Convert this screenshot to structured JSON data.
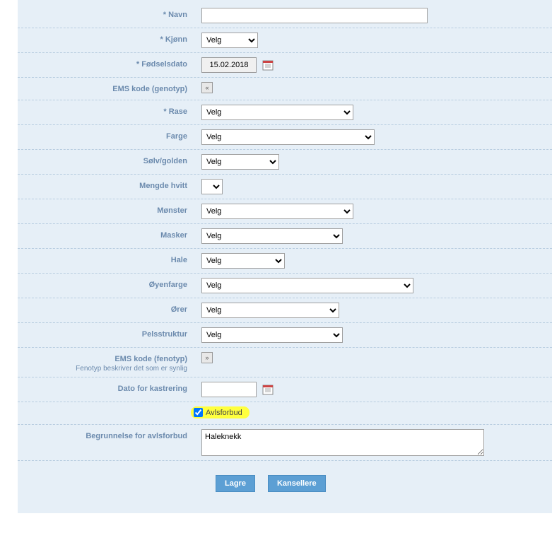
{
  "fields": {
    "navn": {
      "label": "* Navn",
      "value": ""
    },
    "kjonn": {
      "label": "* Kjønn",
      "selected": "Velg"
    },
    "fodselsdato": {
      "label": "* Fødselsdato",
      "value": "15.02.2018"
    },
    "ems_genotyp": {
      "label": "EMS kode (genotyp)"
    },
    "rase": {
      "label": "* Rase",
      "selected": "Velg"
    },
    "farge": {
      "label": "Farge",
      "selected": "Velg"
    },
    "solv_golden": {
      "label": "Sølv/golden",
      "selected": "Velg"
    },
    "mengde_hvitt": {
      "label": "Mengde hvitt",
      "selected": ""
    },
    "monster": {
      "label": "Mønster",
      "selected": "Velg"
    },
    "masker": {
      "label": "Masker",
      "selected": "Velg"
    },
    "hale": {
      "label": "Hale",
      "selected": "Velg"
    },
    "oyenfarge": {
      "label": "Øyenfarge",
      "selected": "Velg"
    },
    "orer": {
      "label": "Ører",
      "selected": "Velg"
    },
    "pelsstruktur": {
      "label": "Pelsstruktur",
      "selected": "Velg"
    },
    "ems_fenotyp": {
      "label": "EMS kode (fenotyp)",
      "sublabel": "Fenotyp beskriver det som er synlig"
    },
    "dato_kastrering": {
      "label": "Dato for kastrering",
      "value": ""
    },
    "avlsforbud": {
      "label": "Avlsforbud",
      "checked": true
    },
    "begrunnelse": {
      "label": "Begrunnelse for avlsforbud",
      "value": "Haleknekk"
    }
  },
  "buttons": {
    "save": "Lagre",
    "cancel": "Kansellere"
  }
}
